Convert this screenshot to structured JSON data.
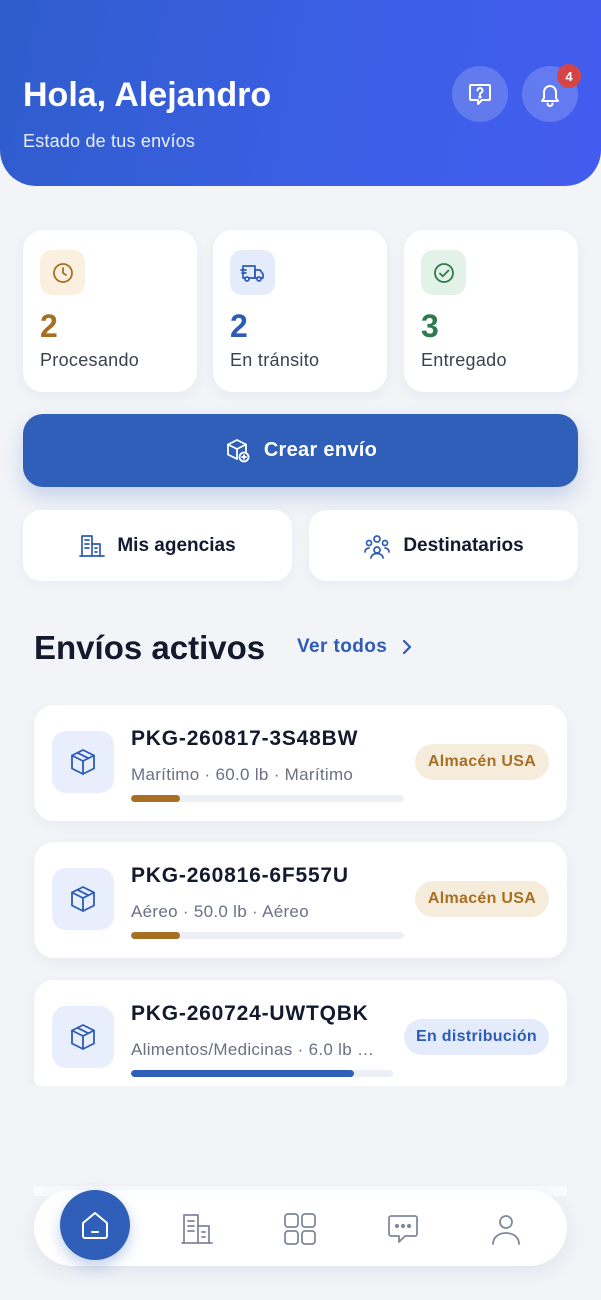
{
  "header": {
    "greeting": "Hola, Alejandro",
    "subtitle": "Estado de tus envíos",
    "help_icon": "help-chat-icon",
    "bell_icon": "bell-icon",
    "notification_count": "4"
  },
  "stats": [
    {
      "value": "2",
      "label": "Procesando",
      "icon": "clock-icon",
      "color": "#a86f24"
    },
    {
      "value": "2",
      "label": "En tránsito",
      "icon": "truck-icon",
      "color": "#2d5bb8"
    },
    {
      "value": "3",
      "label": "Entregado",
      "icon": "check-circle-icon",
      "color": "#2e7a4e"
    }
  ],
  "actions": {
    "create_label": "Crear envío",
    "agencies_label": "Mis agencias",
    "recipients_label": "Destinatarios"
  },
  "active": {
    "title": "Envíos activos",
    "see_all": "Ver todos"
  },
  "shipments": [
    {
      "id": "PKG-260817-3S48BW",
      "meta": "Marítimo · 60.0 lb · Marítimo",
      "status": "Almacén USA",
      "progress": 0.18,
      "status_color": "#a86f24"
    },
    {
      "id": "PKG-260816-6F557U",
      "meta": "Aéreo · 50.0 lb · Aéreo",
      "status": "Almacén USA",
      "progress": 0.18,
      "status_color": "#a86f24"
    },
    {
      "id": "PKG-260724-UWTQBK",
      "meta": "Alimentos/Medicinas · 6.0 lb …",
      "status": "En distribución",
      "progress": 0.85,
      "status_color": "#2d5bb8"
    }
  ],
  "nav": {
    "items": [
      "home-icon",
      "agencies-icon",
      "grid-icon",
      "chat-icon",
      "profile-icon"
    ],
    "active": "home-icon"
  },
  "colors": {
    "primary": "#2f5fb8",
    "header_gradient_start": "#2f5dcc",
    "header_gradient_end": "#435cf0",
    "badge_red": "#d64545"
  }
}
